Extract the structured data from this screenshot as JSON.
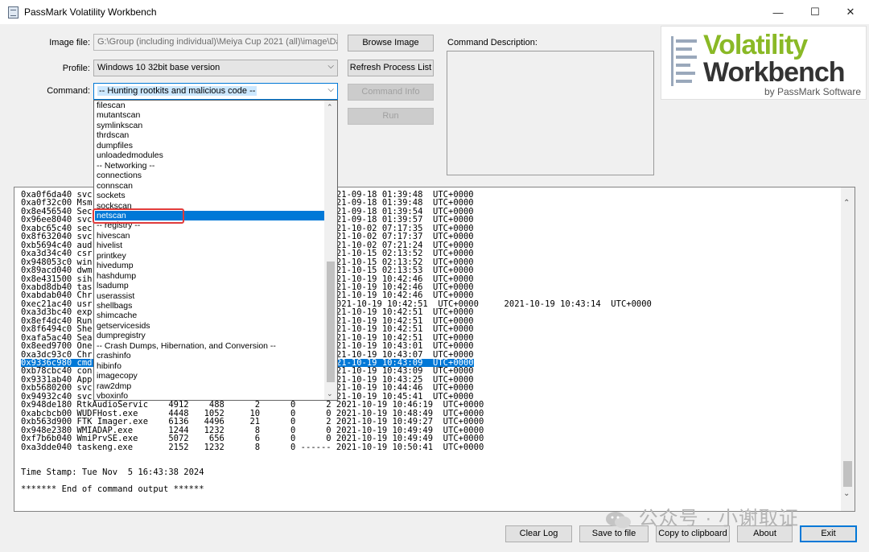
{
  "window": {
    "title": "PassMark Volatility Workbench",
    "minimize": "—",
    "maximize": "☐",
    "close": "✕"
  },
  "form": {
    "image_label": "Image file:",
    "image_value": "G:\\Group (including individual)\\Meiya Cup 2021 (all)\\image\\DaK F",
    "profile_label": "Profile:",
    "profile_value": "Windows 10 32bit base version",
    "command_label": "Command:",
    "command_value": "-- Hunting rootkits and malicious code --"
  },
  "buttons": {
    "browse": "Browse Image",
    "refresh": "Refresh Process List",
    "command_info": "Command Info",
    "run": "Run",
    "clear_log": "Clear Log",
    "save_to_file": "Save to file",
    "copy_clipboard": "Copy to clipboard",
    "about": "About",
    "exit": "Exit"
  },
  "description": {
    "label": "Command Description:"
  },
  "logo": {
    "line1": "Volatility",
    "line2": "Workbench",
    "line3": "by PassMark Software"
  },
  "dropdown": {
    "items": [
      "filescan",
      "mutantscan",
      "symlinkscan",
      "thrdscan",
      "dumpfiles",
      "unloadedmodules",
      "-- Networking --",
      "connections",
      "connscan",
      "sockets",
      "sockscan",
      "netscan",
      "-- registry --",
      "hivescan",
      "hivelist",
      "printkey",
      "hivedump",
      "hashdump",
      "lsadump",
      "userassist",
      "shellbags",
      "shimcache",
      "getservicesids",
      "dumpregistry",
      "-- Crash Dumps, Hibernation, and Conversion --",
      "crashinfo",
      "hibinfo",
      "imagecopy",
      "raw2dmp",
      "vboxinfo"
    ],
    "selected_index": 11
  },
  "output": {
    "rows": [
      "0xa0f6da40 svc                              0      0      0 2021-09-18 01:39:48  UTC+0000",
      "0xa0f32c00 Msm                              0      0      0 2021-09-18 01:39:48  UTC+0000",
      "0x8e456540 Sec                              0      0      0 2021-09-18 01:39:54  UTC+0000",
      "0x96ee8040 svc                              0      0      0 2021-09-18 01:39:57  UTC+0000",
      "0xabc65c40 sec                              0      0      0 2021-10-02 07:17:35  UTC+0000",
      "0x8f632040 svc                              0      0      0 2021-10-02 07:17:37  UTC+0000",
      "0xb5694c40 aud                              0      0      0 2021-10-02 07:21:24  UTC+0000",
      "0xa3d34c40 csr                              0      2      0 2021-10-15 02:13:52  UTC+0000",
      "0x948053c0 win                              0      2      0 2021-10-15 02:13:52  UTC+0000",
      "0x89acd040 dwm                              0      2      0 2021-10-15 02:13:53  UTC+0000",
      "0x8e431500 sih                              0      2      0 2021-10-19 10:42:46  UTC+0000",
      "0xabd8db40 tas                              0      2      0 2021-10-19 10:42:46  UTC+0000",
      "0xabdab040 Chr                              0      2      0 2021-10-19 10:42:46  UTC+0000",
      "0xec21ac40 usr                          ------      2      0 2021-10-19 10:42:51  UTC+0000     2021-10-19 10:43:14  UTC+0000",
      "0xa3d3bc40 exp                              0      2      0 2021-10-19 10:42:51  UTC+0000",
      "0x8ef4dc40 Run                              0      2      0 2021-10-19 10:42:51  UTC+0000",
      "0x8f6494c0 She                              0      2      0 2021-10-19 10:42:51  UTC+0000",
      "0xafa5ac40 Sea                              0      2      0 2021-10-19 10:42:51  UTC+0000",
      "0x8eed9700 One                              0      2      0 2021-10-19 10:43:01  UTC+0000",
      "0xa3dc93c0 Chr                              0      2      0 2021-10-19 10:43:07  UTC+0000",
      "0x9336c980 cmd                              0      2      0 2021-10-19 10:43:09  UTC+0000",
      "0xb78cbc40 con                              0      2      0 2021-10-19 10:43:09  UTC+0000",
      "0x9331ab40 App                              0      2      0 2021-10-19 10:43:25  UTC+0000",
      "0xb5680200 svc                              0      0      0 2021-10-19 10:44:46  UTC+0000",
      "0x94932c40 svc                              0      0      0 2021-10-19 10:45:41  UTC+0000",
      "0x948de180 RtkAudioServic    4912    488      2      0      2 2021-10-19 10:46:19  UTC+0000",
      "0xabcbcb00 WUDFHost.exe      4448   1052     10      0      0 2021-10-19 10:48:49  UTC+0000",
      "0xb563d900 FTK Imager.exe    6136   4496     21      0      2 2021-10-19 10:49:27  UTC+0000",
      "0x948e2380 WMIADAP.exe       1244   1232      8      0      0 2021-10-19 10:49:49  UTC+0000",
      "0xf7b6b040 WmiPrvSE.exe      5072    656      6      0      0 2021-10-19 10:49:49  UTC+0000",
      "0xa3dde040 taskeng.exe       2152   1232      8      0 ------ 2021-10-19 10:50:41  UTC+0000",
      "",
      "",
      "Time Stamp: Tue Nov  5 16:43:38 2024",
      "",
      "******* End of command output ******"
    ],
    "selected_index": 20
  },
  "watermark": "公众号 · 小谢取证"
}
